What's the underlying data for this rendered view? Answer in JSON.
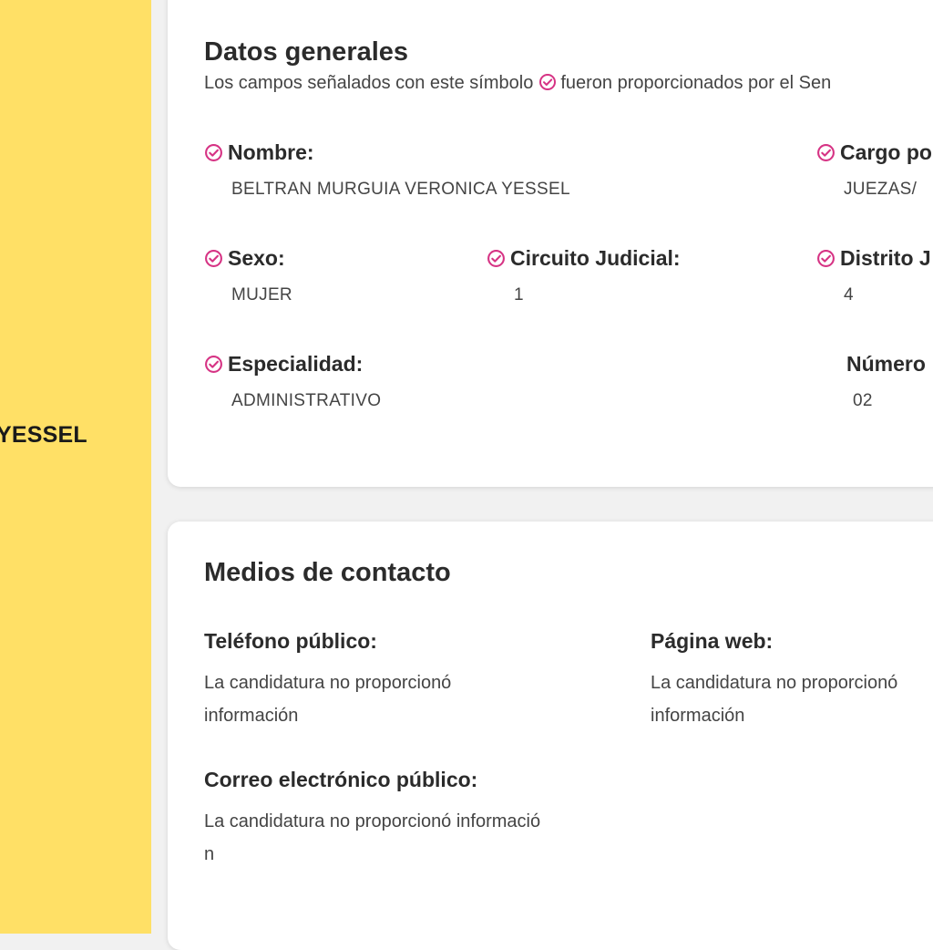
{
  "sidebar": {
    "candidate_name_fragment": "YESSEL"
  },
  "general": {
    "title": "Datos generales",
    "subtitle_before": "Los campos señalados con este símbolo",
    "subtitle_after": "fueron proporcionados por el Sen",
    "fields": {
      "nombre": {
        "label": "Nombre:",
        "value": "BELTRAN MURGUIA VERONICA YESSEL"
      },
      "cargo": {
        "label": "Cargo po",
        "value": "JUEZAS/"
      },
      "sexo": {
        "label": "Sexo:",
        "value": "MUJER"
      },
      "circuito": {
        "label": "Circuito Judicial:",
        "value": "1"
      },
      "distrito": {
        "label": "Distrito J",
        "value": "4"
      },
      "especialidad": {
        "label": "Especialidad:",
        "value": "ADMINISTRATIVO"
      },
      "numero": {
        "label": "Número",
        "value": "02"
      }
    }
  },
  "contact": {
    "title": "Medios de contacto",
    "telefono": {
      "label": "Teléfono público:",
      "value_line1": "La candidatura no proporcionó",
      "value_line2": "información"
    },
    "web": {
      "label": "Página web:",
      "value_line1": "La candidatura no proporcionó",
      "value_line2": "información"
    },
    "correo": {
      "label": "Correo electrónico público:",
      "value_line1": "La candidatura no proporcionó informació",
      "value_line2": "n"
    }
  },
  "colors": {
    "accent": "#d63384",
    "sidebar": "#ffe066"
  }
}
